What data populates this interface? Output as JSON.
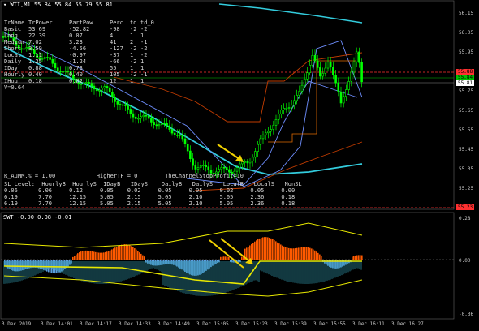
{
  "main_panel": {
    "title": "WTI,M1  55.84 55.84 55.79 55.81",
    "stats_table": {
      "headers": [
        "TrName",
        "TrPower",
        "PartPow",
        "Perc",
        "td",
        "td_0"
      ],
      "rows": [
        [
          "Basic",
          "53.69",
          "-52.82",
          "-98",
          "-2",
          "-2"
        ],
        [
          "Long",
          "22.39",
          "0.07",
          "4",
          "1",
          "1"
        ],
        [
          "Medium",
          "7.02",
          "3.23",
          "41",
          "2",
          "-1"
        ],
        [
          "Short",
          "3.59",
          "-4.56",
          "-127",
          "-2",
          "-2"
        ],
        [
          "Local",
          "1.11",
          "-0.97",
          "-37",
          "1",
          "-2"
        ],
        [
          "Daily",
          "1.25",
          "-1.24",
          "-66",
          "-2",
          "1"
        ],
        [
          "IDay",
          "0.88",
          "0.73",
          "55",
          "1",
          "1"
        ],
        [
          "Hourly",
          "0.40",
          "0.40",
          "105",
          "-2",
          "-1"
        ],
        [
          "IHour",
          "0.18",
          "0.02",
          "12",
          "1",
          "1"
        ]
      ],
      "footer": "V=0.64"
    },
    "mm_line1": "R_AuMM,% = 1.00            HigherTF = 0        TheChannelStopProfit=10",
    "sl_table": {
      "headers": "SL_Level:  HourlyB  HourlyS  IDayB   IDayS    DailyB   DailyS   LocalB   LocalS   NonSL",
      "rows": [
        "0.06      0.06     0.12     0.05    0.02     0.05     0.05     0.02     0.05     0.00",
        "6.19      7.70     12.15    5.05    2.15     5.05     2.10     5.05     2.36     0.18",
        "6.19      7.70     12.15    5.05    2.15     5.05     2.10     5.05     2.36     0.18"
      ]
    },
    "price_axis": [
      "56.15",
      "56.05",
      "55.95",
      "55.85",
      "55.75",
      "55.65",
      "55.55",
      "55.45",
      "55.35",
      "55.25"
    ],
    "price_tags": [
      {
        "label": "55.88",
        "color": "#ff3030"
      },
      {
        "label": "55.84",
        "color": "#00c000"
      },
      {
        "label": "55.81",
        "color": "#ffffff"
      },
      {
        "label": "55.23",
        "color": "#ff3030"
      }
    ]
  },
  "sub_panel": {
    "title": "SWT -0.00 0.08 -0.01",
    "axis": [
      "0.28",
      "0.00",
      "-0.36"
    ]
  },
  "time_axis": [
    "3 Dec 2019",
    "3 Dec 14:01",
    "3 Dec 14:17",
    "3 Dec 14:33",
    "3 Dec 14:49",
    "3 Dec 15:05",
    "3 Dec 15:23",
    "3 Dec 15:39",
    "3 Dec 15:55",
    "3 Dec 16:11",
    "3 Dec 16:27"
  ],
  "colors": {
    "background": "#000000",
    "bull": "#00ff00",
    "bear": "#ff0000",
    "ma_cyan": "#33ccdd",
    "ma_blue": "#6f8fff",
    "envelope_red": "#c23c00",
    "envelope_yellow": "#e8e800",
    "arrow": "#f0d000",
    "osc_orange": "#ff5a00",
    "osc_blue": "#5aa0e0"
  }
}
